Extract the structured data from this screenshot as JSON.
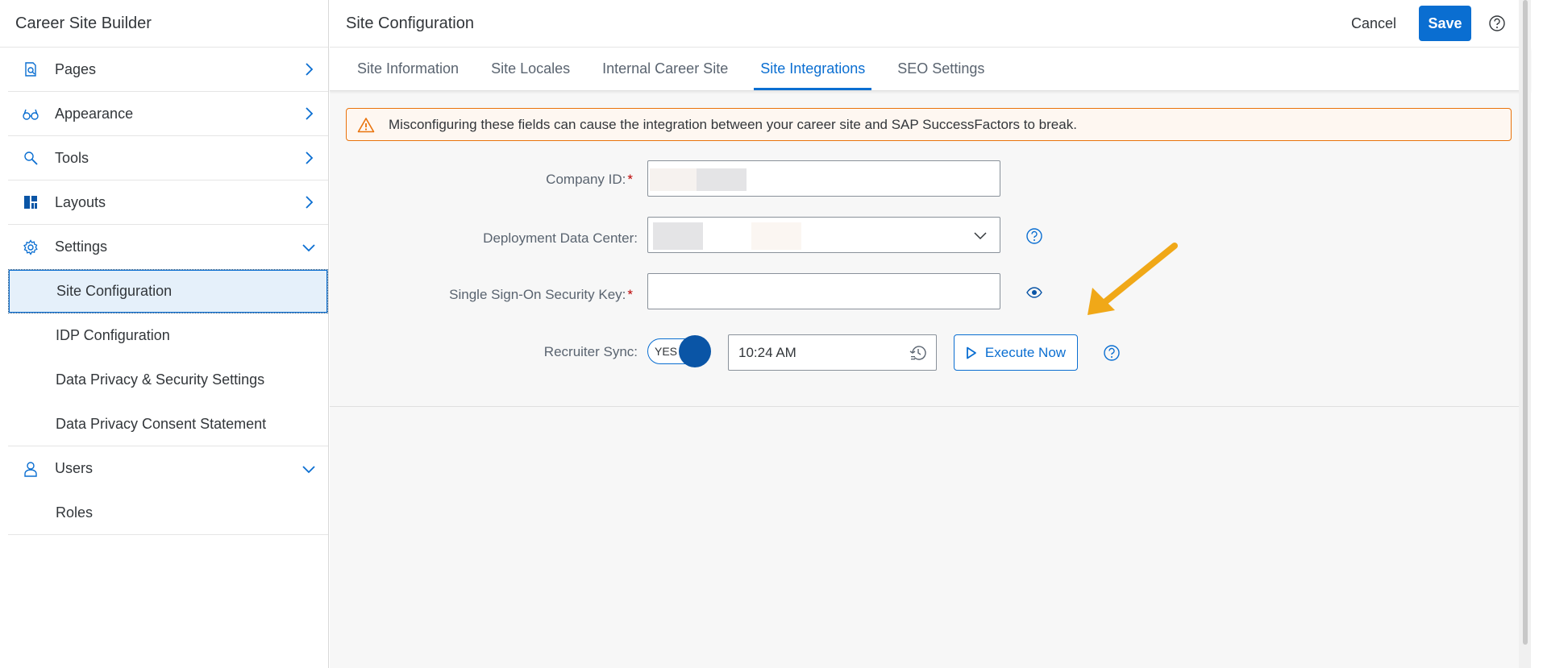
{
  "sidebar": {
    "title": "Career Site Builder",
    "items": [
      {
        "label": "Pages",
        "icon": "pages-icon"
      },
      {
        "label": "Appearance",
        "icon": "glasses-icon"
      },
      {
        "label": "Tools",
        "icon": "tools-icon"
      },
      {
        "label": "Layouts",
        "icon": "layouts-icon"
      },
      {
        "label": "Settings",
        "icon": "gear-icon"
      }
    ],
    "settings_sub": [
      {
        "label": "Site Configuration"
      },
      {
        "label": "IDP Configuration"
      },
      {
        "label": "Data Privacy & Security Settings"
      },
      {
        "label": "Data Privacy Consent Statement"
      }
    ],
    "users": {
      "label": "Users",
      "icon": "user-icon"
    },
    "users_sub": [
      {
        "label": "Roles"
      }
    ]
  },
  "header": {
    "title": "Site Configuration",
    "cancel_label": "Cancel",
    "save_label": "Save"
  },
  "tabs": [
    {
      "label": "Site Information"
    },
    {
      "label": "Site Locales"
    },
    {
      "label": "Internal Career Site"
    },
    {
      "label": "Site Integrations"
    },
    {
      "label": "SEO Settings"
    }
  ],
  "active_tab": "Site Integrations",
  "warning": {
    "text": "Misconfiguring these fields can cause the integration between your career site and SAP SuccessFactors to break."
  },
  "form": {
    "company_id_label": "Company ID:",
    "deployment_label": "Deployment Data Center:",
    "sso_label": "Single Sign-On Security Key:",
    "recruiter_sync_label": "Recruiter Sync:",
    "toggle_label": "YES",
    "time_value": "10:24 AM",
    "execute_label": "Execute Now"
  },
  "colors": {
    "accent": "#0a6ed1",
    "warning": "#e9730c",
    "arrow": "#f0a818"
  }
}
